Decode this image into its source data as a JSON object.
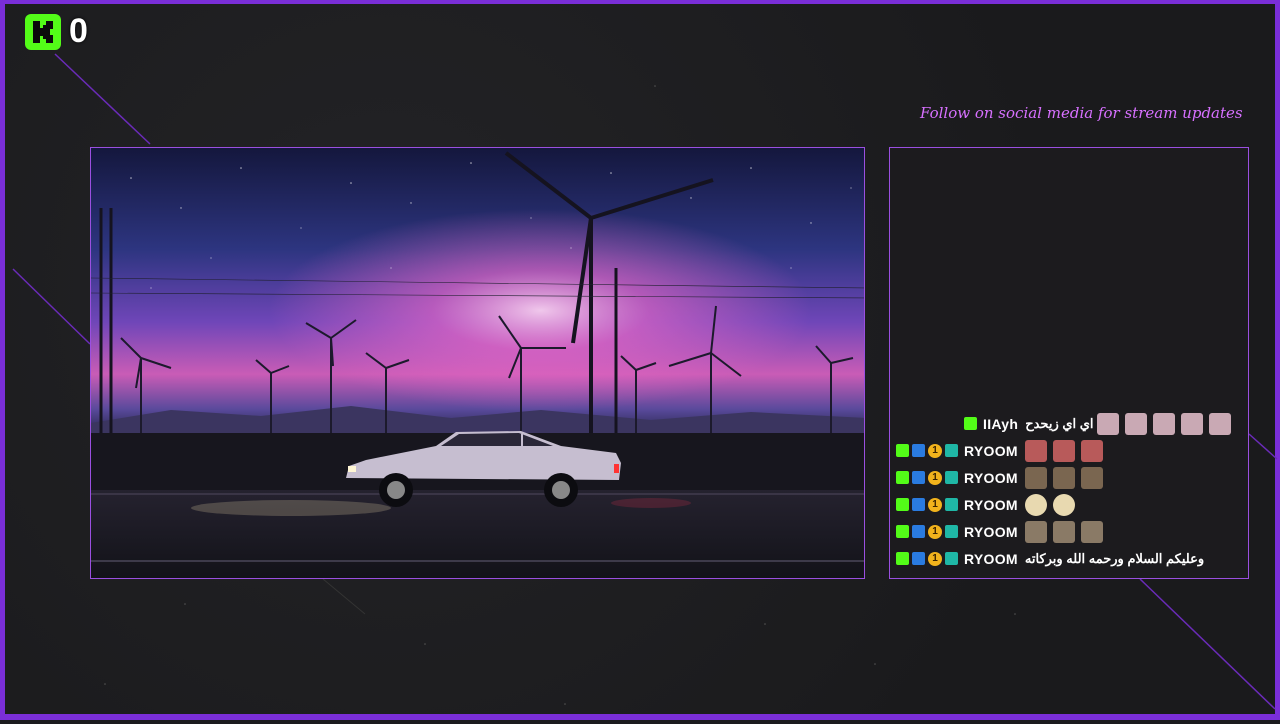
{
  "overlay": {
    "viewer_count": "0",
    "social_banner": "Follow on social media for stream updates",
    "colors": {
      "accent": "#7a2ed8",
      "kick_green": "#53fc18",
      "social_text": "#d770ff"
    }
  },
  "chat": {
    "messages": [
      {
        "username": "IIAyh",
        "text": "اي اي زيحدح",
        "badges": [
          "kick"
        ],
        "emotes": 5
      },
      {
        "username": "RYOOM",
        "text": "",
        "badges": [
          "kick",
          "subscriber",
          "gifter",
          "og"
        ],
        "emotes": 3
      },
      {
        "username": "RYOOM",
        "text": "",
        "badges": [
          "kick",
          "subscriber",
          "gifter",
          "og"
        ],
        "emotes": 3
      },
      {
        "username": "RYOOM",
        "text": "",
        "badges": [
          "kick",
          "subscriber",
          "gifter",
          "og"
        ],
        "emotes": 2
      },
      {
        "username": "RYOOM",
        "text": "",
        "badges": [
          "kick",
          "subscriber",
          "gifter",
          "og"
        ],
        "emotes": 3
      },
      {
        "username": "RYOOM",
        "text": "وعليكم السلام ورحمه الله وبركاته",
        "badges": [
          "kick",
          "subscriber",
          "gifter",
          "og"
        ],
        "emotes": 0
      }
    ],
    "gift_badge_label": "1"
  },
  "game": {
    "scene": "night-road-wind-turbines-car",
    "palette": [
      "#1a1f4a",
      "#6b3fb8",
      "#e86cc4",
      "#f4b8e0"
    ]
  }
}
